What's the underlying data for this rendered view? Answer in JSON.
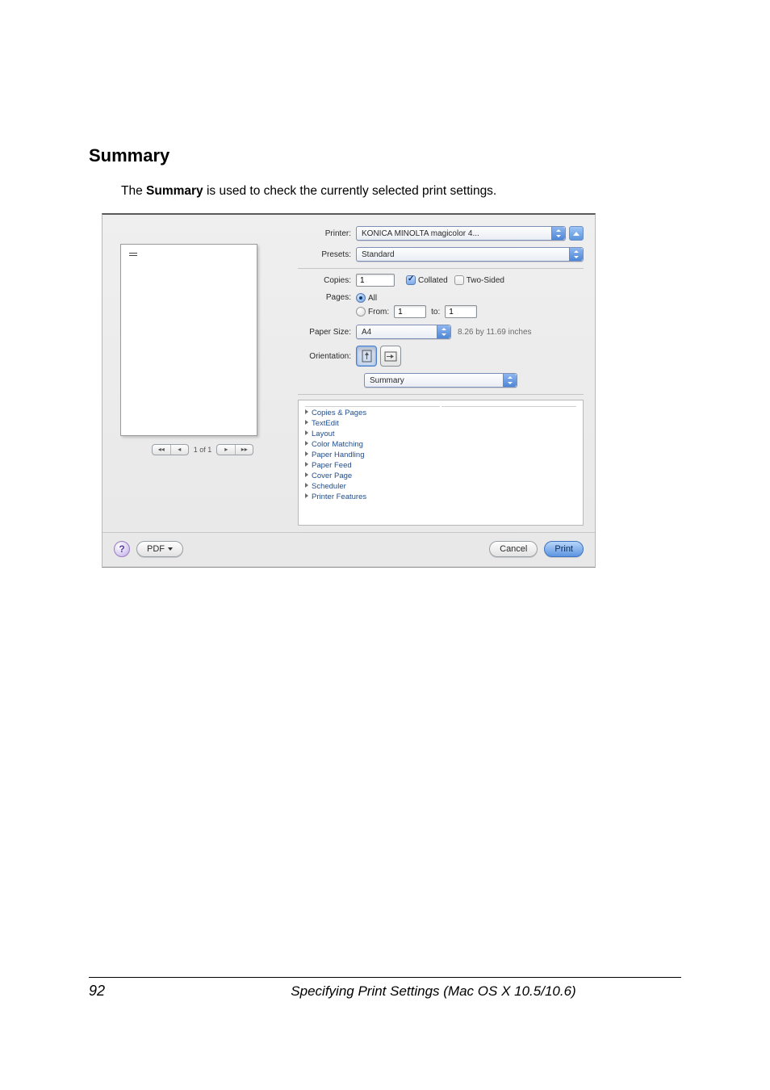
{
  "section_title": "Summary",
  "intro_pre": "The ",
  "intro_bold": "Summary",
  "intro_post": " is used to check the currently selected print settings.",
  "dialog": {
    "printer_label": "Printer:",
    "printer_value": "KONICA MINOLTA magicolor 4...",
    "presets_label": "Presets:",
    "presets_value": "Standard",
    "copies_label": "Copies:",
    "copies_value": "1",
    "collated_label": "Collated",
    "two_sided_label": "Two-Sided",
    "pages_label": "Pages:",
    "pages_all": "All",
    "pages_from_label": "From:",
    "pages_from_value": "1",
    "pages_to_label": "to:",
    "pages_to_value": "1",
    "paper_size_label": "Paper Size:",
    "paper_size_value": "A4",
    "paper_size_dims": "8.26 by 11.69 inches",
    "orientation_label": "Orientation:",
    "section_combo": "Summary",
    "pager_text": "1 of 1",
    "pager_first": "◂◂",
    "pager_prev": "◂",
    "pager_next": "▸",
    "pager_last": "▸▸",
    "summary_items": [
      "Copies & Pages",
      "TextEdit",
      "Layout",
      "Color Matching",
      "Paper Handling",
      "Paper Feed",
      "Cover Page",
      "Scheduler",
      "Printer Features"
    ],
    "help_glyph": "?",
    "pdf_label": "PDF",
    "cancel_label": "Cancel",
    "print_label": "Print"
  },
  "footer": {
    "page_number": "92",
    "title": "Specifying Print Settings (Mac OS X 10.5/10.6)"
  }
}
